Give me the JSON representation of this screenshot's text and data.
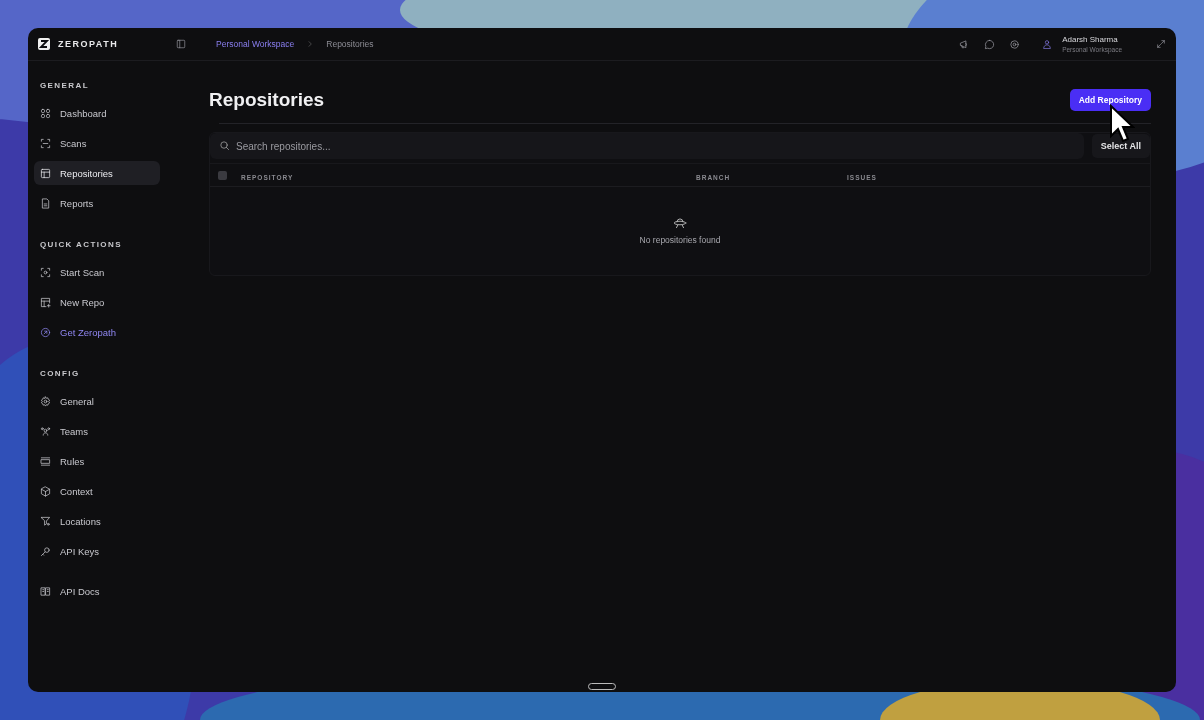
{
  "brand": {
    "name": "ZEROPATH"
  },
  "breadcrumb": [
    {
      "label": "Personal Workspace",
      "current": false
    },
    {
      "label": "Repositories",
      "current": true
    }
  ],
  "user": {
    "name": "Adarsh Sharma",
    "workspace": "Personal Workspace"
  },
  "sidebar": {
    "sections": [
      {
        "title": "GENERAL",
        "items": [
          {
            "label": "Dashboard",
            "selected": false,
            "kind": "nav"
          },
          {
            "label": "Scans",
            "selected": false,
            "kind": "nav"
          },
          {
            "label": "Repositories",
            "selected": true,
            "kind": "nav"
          },
          {
            "label": "Reports",
            "selected": false,
            "kind": "nav"
          }
        ]
      },
      {
        "title": "QUICK ACTIONS",
        "items": [
          {
            "label": "Start Scan",
            "selected": false,
            "kind": "nav"
          },
          {
            "label": "New Repo",
            "selected": false,
            "kind": "nav"
          },
          {
            "label": "Get Zeropath",
            "selected": false,
            "kind": "accent"
          }
        ]
      },
      {
        "title": "CONFIG",
        "items": [
          {
            "label": "General",
            "selected": false,
            "kind": "nav"
          },
          {
            "label": "Teams",
            "selected": false,
            "kind": "nav"
          },
          {
            "label": "Rules",
            "selected": false,
            "kind": "nav"
          },
          {
            "label": "Context",
            "selected": false,
            "kind": "nav"
          },
          {
            "label": "Locations",
            "selected": false,
            "kind": "nav"
          },
          {
            "label": "API Keys",
            "selected": false,
            "kind": "nav"
          }
        ]
      },
      {
        "items": [
          {
            "label": "API Docs",
            "selected": false,
            "kind": "nav"
          }
        ]
      }
    ]
  },
  "page": {
    "title": "Repositories",
    "add_button": "Add Repository",
    "search": {
      "placeholder": "Search repositories..."
    },
    "select_all": "Select All",
    "table": {
      "columns": [
        "REPOSITORY",
        "BRANCH",
        "ISSUES"
      ],
      "select_all_checked": false,
      "empty_message": "No repositories found"
    }
  }
}
